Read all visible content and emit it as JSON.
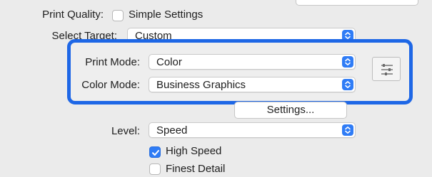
{
  "print_quality": {
    "label": "Print Quality:",
    "simple_settings_label": "Simple Settings",
    "simple_settings_checked": false
  },
  "select_target": {
    "label": "Select Target:",
    "value": "Custom"
  },
  "print_mode": {
    "label": "Print Mode:",
    "value": "Color"
  },
  "color_mode": {
    "label": "Color Mode:",
    "value": "Business Graphics"
  },
  "settings_button": {
    "label": "Settings..."
  },
  "level": {
    "label": "Level:",
    "value": "Speed"
  },
  "high_speed": {
    "label": "High Speed",
    "checked": true
  },
  "finest_detail": {
    "label": "Finest Detail",
    "checked": false
  },
  "colors": {
    "accent": "#2f7cf6",
    "focus_ring": "#1e67e6",
    "background": "#ebebeb"
  },
  "icons": {
    "stepper": "up-down-chevron-icon",
    "advanced": "sliders-icon",
    "check": "checkmark-icon"
  }
}
